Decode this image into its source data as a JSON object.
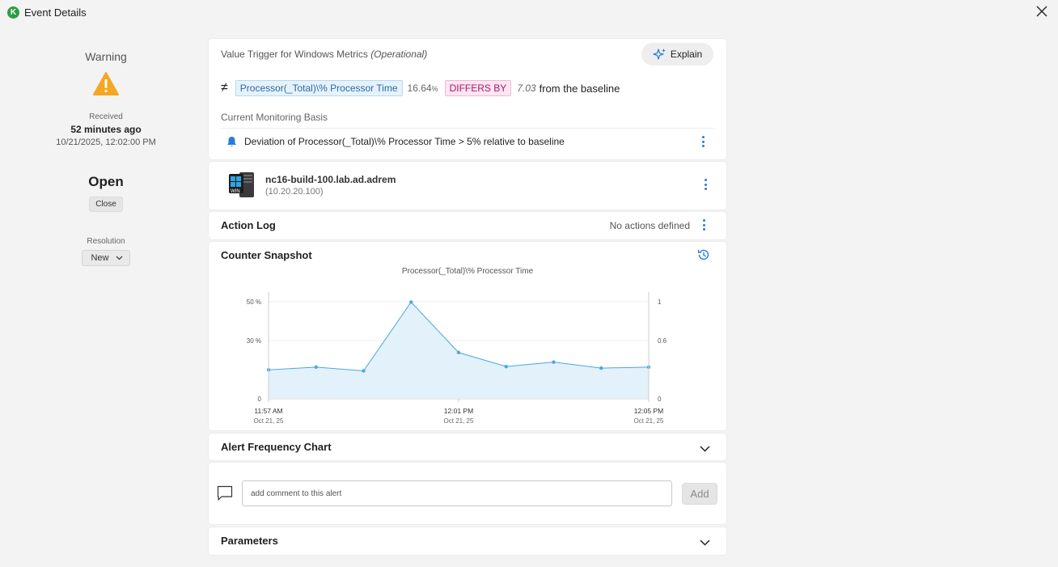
{
  "window": {
    "title": "Event Details",
    "app_icon_letter": "K"
  },
  "status": {
    "severity": "Warning",
    "received_label": "Received",
    "received_ago": "52 minutes ago",
    "received_datetime": "10/21/2025, 12:02:00 PM",
    "state": "Open",
    "close_button": "Close",
    "resolution_label": "Resolution",
    "resolution_value": "New"
  },
  "trigger": {
    "title": "Value Trigger for Windows Metrics",
    "mode": "(Operational)",
    "explain_label": "Explain",
    "operator_symbol": "≠",
    "metric": "Processor(_Total)\\% Processor Time",
    "current_value": "16.64",
    "current_unit": "%",
    "differs_label": "DIFFERS BY",
    "difference": "7.03",
    "baseline_text": "from the baseline",
    "basis_label": "Current Monitoring Basis",
    "basis_rule": "Deviation of Processor(_Total)\\% Processor Time > 5% relative to baseline"
  },
  "device": {
    "name": "nc16-build-100.lab.ad.adrem",
    "ip": "(10.20.20.100)",
    "os_badge": "WIN"
  },
  "action_log": {
    "title": "Action Log",
    "status": "No actions defined"
  },
  "snapshot": {
    "title": "Counter Snapshot"
  },
  "chart_data": {
    "type": "area",
    "title": "Processor(_Total)\\% Processor Time",
    "x": [
      "11:57 AM",
      "11:58 AM",
      "11:59 AM",
      "12:00 PM",
      "12:01 PM",
      "12:02 PM",
      "12:03 PM",
      "12:04 PM",
      "12:05 PM"
    ],
    "series": [
      {
        "values": [
          14.9,
          16.3,
          14.4,
          49.8,
          23.8,
          16.6,
          18.9,
          15.8,
          16.3
        ]
      }
    ],
    "ylim": [
      0,
      60
    ],
    "y_ticks": [
      "0",
      "30 %",
      "50 %"
    ],
    "y_tick_values": [
      0,
      30,
      50
    ],
    "y2_ticks": [
      "0",
      "0.6",
      "1"
    ],
    "x_tick_labels": [
      {
        "time": "11:57 AM",
        "date": "Oct 21, 25"
      },
      {
        "time": "12:01 PM",
        "date": "Oct 21, 25"
      },
      {
        "time": "12:05 PM",
        "date": "Oct 21, 25"
      }
    ],
    "color": "#4ba8e0",
    "fill": "#e3f1fb"
  },
  "alert_frequency": {
    "title": "Alert Frequency Chart"
  },
  "comment": {
    "placeholder": "add comment to this alert",
    "add_label": "Add"
  },
  "parameters": {
    "title": "Parameters"
  }
}
